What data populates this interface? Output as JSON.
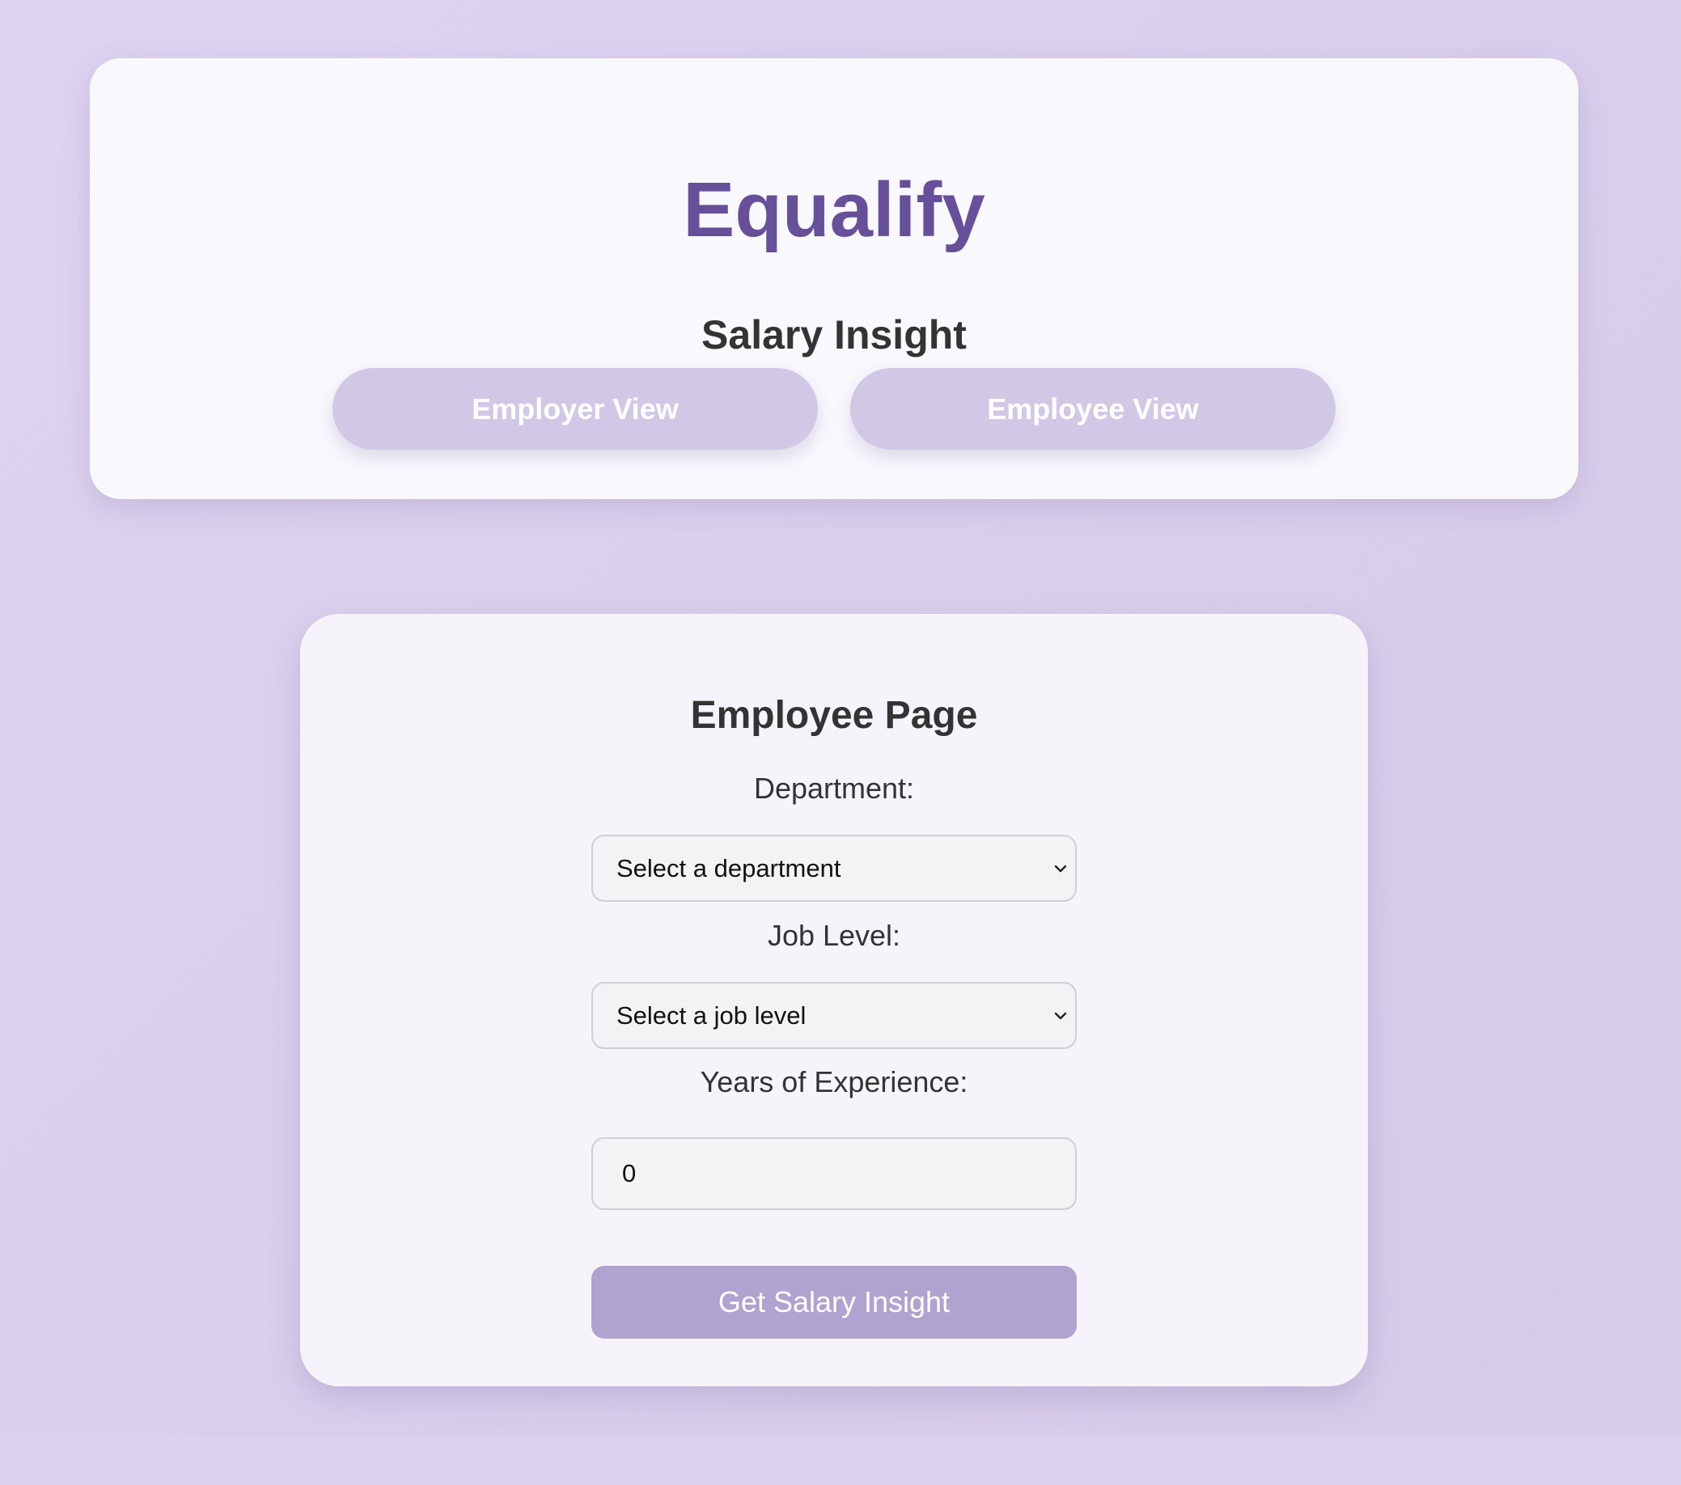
{
  "header": {
    "app_title": "Equalify",
    "subtitle": "Salary Insight",
    "buttons": {
      "employer_view": "Employer View",
      "employee_view": "Employee View"
    }
  },
  "employee_page": {
    "title": "Employee Page",
    "department": {
      "label": "Department:",
      "selected": "Select a department"
    },
    "job_level": {
      "label": "Job Level:",
      "selected": "Select a job level"
    },
    "years_experience": {
      "label": "Years of Experience:",
      "value": "0"
    },
    "submit_label": "Get Salary Insight"
  },
  "colors": {
    "brand": "#66509a",
    "view_button": "#d1c8e6",
    "submit_button": "#b0a3cf",
    "background": "#dcd2ef"
  },
  "icons": {
    "select_chevron": "chevron-down-icon"
  }
}
